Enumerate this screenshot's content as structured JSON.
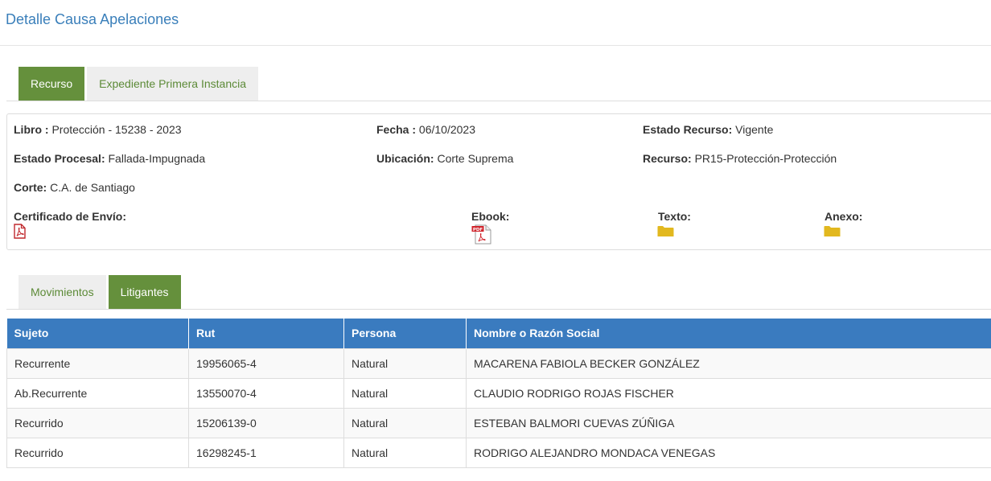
{
  "page": {
    "title": "Detalle Causa Apelaciones"
  },
  "tabs_top": [
    {
      "label": "Recurso",
      "active": true
    },
    {
      "label": "Expediente Primera Instancia",
      "active": false
    }
  ],
  "details": {
    "libro": {
      "label": "Libro :",
      "value": "Protección - 15238 - 2023"
    },
    "fecha": {
      "label": "Fecha :",
      "value": "06/10/2023"
    },
    "estado_recurso": {
      "label": "Estado Recurso:",
      "value": "Vigente"
    },
    "estado_procesal": {
      "label": "Estado Procesal:",
      "value": "Fallada-Impugnada"
    },
    "ubicacion": {
      "label": "Ubicación:",
      "value": "Corte Suprema"
    },
    "recurso": {
      "label": "Recurso:",
      "value": "PR15-Protección-Protección"
    },
    "corte": {
      "label": "Corte:",
      "value": "C.A. de Santiago"
    },
    "certificado": {
      "label": "Certificado de Envío:"
    },
    "ebook": {
      "label": "Ebook:"
    },
    "texto": {
      "label": "Texto:"
    },
    "anexo": {
      "label": "Anexo:"
    }
  },
  "icons": {
    "certificado": "pdf-outline-icon",
    "ebook": "pdf-file-icon",
    "texto": "folder-icon",
    "anexo": "folder-icon"
  },
  "tabs_bottom": [
    {
      "label": "Movimientos",
      "active": false
    },
    {
      "label": "Litigantes",
      "active": true
    }
  ],
  "litigantes": {
    "headers": [
      "Sujeto",
      "Rut",
      "Persona",
      "Nombre o Razón Social"
    ],
    "rows": [
      [
        "Recurrente",
        "19956065-4",
        "Natural",
        "MACARENA FABIOLA BECKER GONZÁLEZ"
      ],
      [
        "Ab.Recurrente",
        "13550070-4",
        "Natural",
        "CLAUDIO RODRIGO ROJAS FISCHER"
      ],
      [
        "Recurrido",
        "15206139-0",
        "Natural",
        "ESTEBAN BALMORI CUEVAS ZÚÑIGA"
      ],
      [
        "Recurrido",
        "16298245-1",
        "Natural",
        "RODRIGO ALEJANDRO MONDACA VENEGAS"
      ]
    ]
  },
  "colors": {
    "title": "#3a7fba",
    "tab_active": "#65903c",
    "tab_text": "#5c8a37",
    "table_header": "#3a7bbf",
    "folder": "#e2b81f",
    "pdf": "#c0282d"
  }
}
